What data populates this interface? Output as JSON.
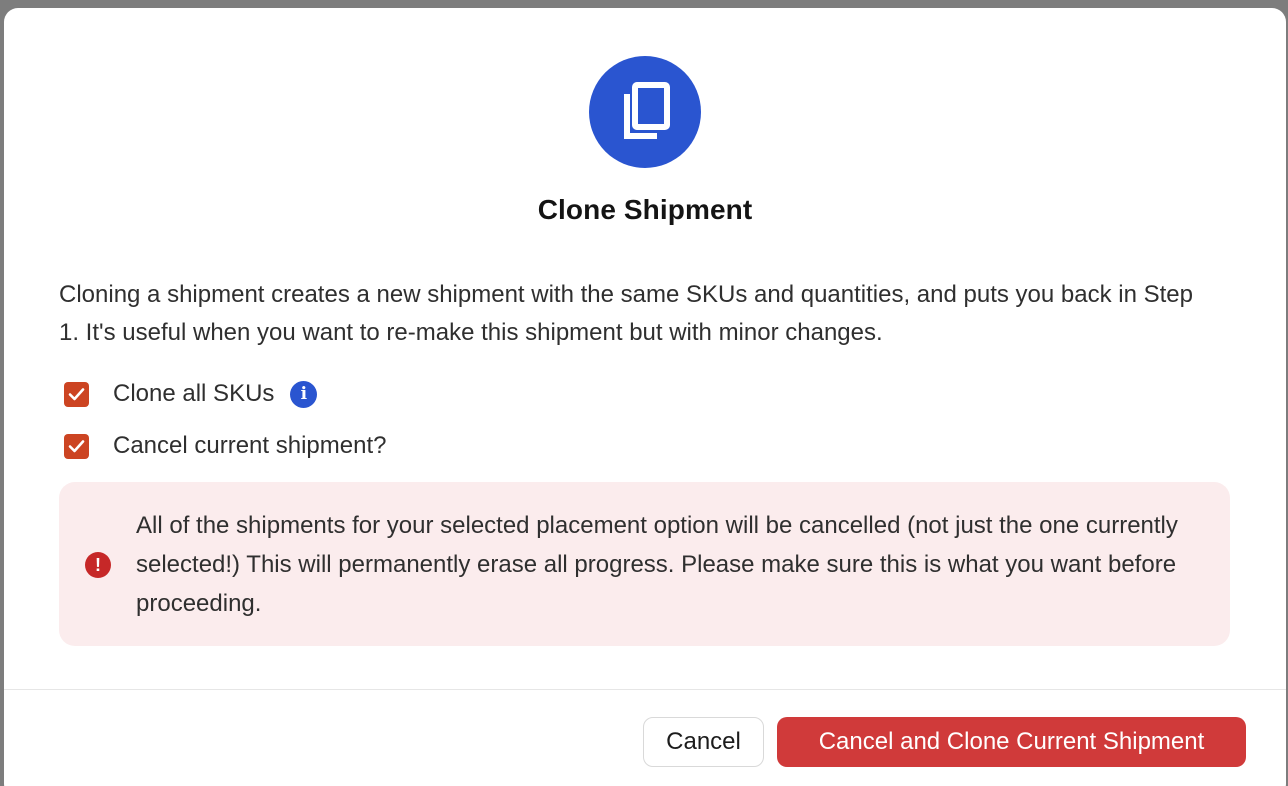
{
  "modal": {
    "icon": "copy-icon",
    "title": "Clone Shipment",
    "description": "Cloning a shipment creates a new shipment with the same SKUs and quantities, and puts you back in Step 1. It's useful when you want to re-make this shipment but with minor changes.",
    "options": [
      {
        "label": "Clone all SKUs",
        "checked": true,
        "has_info_icon": true
      },
      {
        "label": "Cancel current shipment?",
        "checked": true,
        "has_info_icon": false
      }
    ],
    "warning": {
      "icon": "error-icon",
      "text": "All of the shipments for your selected placement option will be cancelled (not just the one currently selected!) This will permanently erase all progress. Please make sure this is what you want before proceeding."
    },
    "footer": {
      "cancel_label": "Cancel",
      "confirm_label": "Cancel and Clone Current Shipment"
    }
  },
  "colors": {
    "brand_blue": "#2a55d0",
    "checkbox": "#cc4422",
    "danger": "#d03a3a",
    "warning_bg": "#fbeced"
  }
}
